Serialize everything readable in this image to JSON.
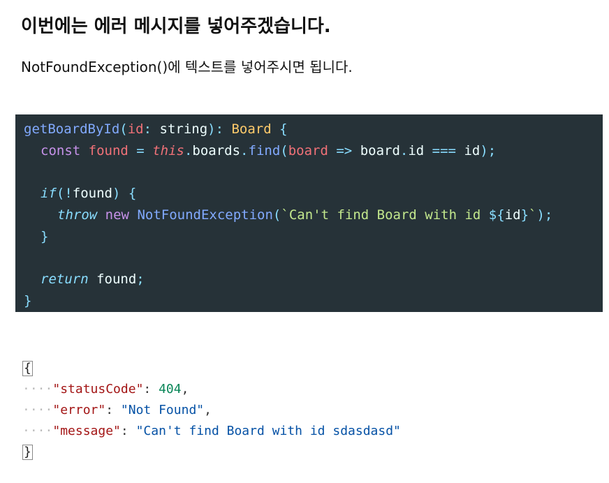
{
  "heading": "이번에는 에러 메시지를 넣어주겠습니다.",
  "paragraph": "NotFoundException()에 텍스트를 넣어주시면 됩니다.",
  "code": {
    "l1": {
      "fn": "getBoardById",
      "op": "(",
      "param": "id",
      "colon": ": ",
      "ptype": "string",
      "close": "): ",
      "rtype": "Board",
      "brace": " {"
    },
    "l2": {
      "kw": "const",
      "sp1": " ",
      "var": "found",
      "eq": " = ",
      "this": "this",
      "dot1": ".",
      "prop": "boards",
      "dot2": ".",
      "method": "find",
      "op": "(",
      "param": "board",
      "arrow": " => ",
      "obj": "board",
      "dot3": ".",
      "field": "id",
      "cmp": " === ",
      "id": "id",
      "end": ");"
    },
    "l3": {
      "kw": "if",
      "op": "(",
      "not": "!",
      "var": "found",
      "cl": ") {"
    },
    "l4": {
      "kw": "throw",
      "sp": " ",
      "new": "new",
      "sp2": " ",
      "cls": "NotFoundException",
      "op": "(",
      "tick": "`",
      "str": "Can't find Board with id ",
      "tpl_open": "${",
      "tpl_var": "id",
      "tpl_close": "}",
      "tick2": "`",
      "end": ");"
    },
    "l5": "}",
    "l6": {
      "kw": "return",
      "sp": " ",
      "var": "found",
      "end": ";"
    },
    "l7": "}"
  },
  "json_response": {
    "open": "{",
    "dots": "····",
    "rows": [
      {
        "key": "\"statusCode\"",
        "colon": ": ",
        "value": "404",
        "comma": ","
      },
      {
        "key": "\"error\"",
        "colon": ": ",
        "value": "\"Not Found\"",
        "comma": ","
      },
      {
        "key": "\"message\"",
        "colon": ": ",
        "value": "\"Can't find Board with id sdasdasd\"",
        "comma": ""
      }
    ],
    "close": "}"
  }
}
